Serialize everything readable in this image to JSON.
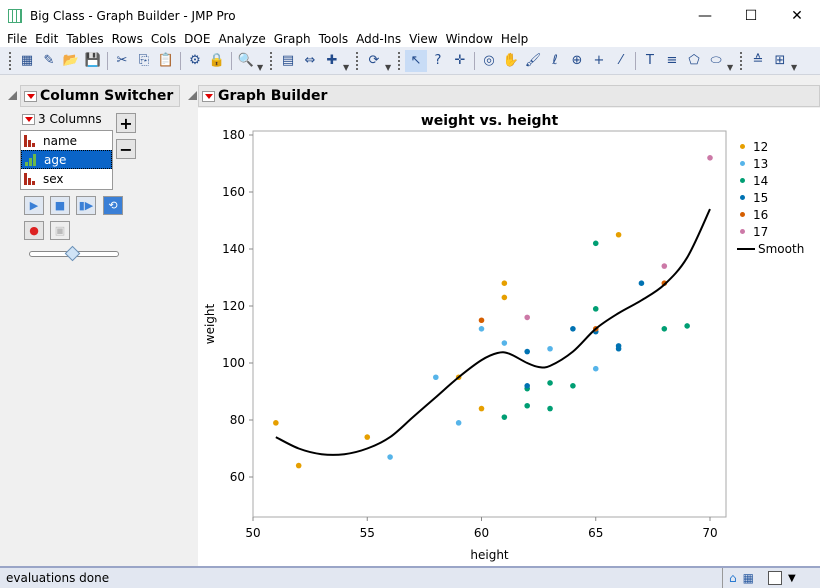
{
  "window": {
    "title": "Big Class - Graph Builder - JMP Pro",
    "minimize": "—",
    "maximize": "☐",
    "close": "✕"
  },
  "menu": [
    "File",
    "Edit",
    "Tables",
    "Rows",
    "Cols",
    "DOE",
    "Analyze",
    "Graph",
    "Tools",
    "Add-Ins",
    "View",
    "Window",
    "Help"
  ],
  "toolbar": {
    "icons": [
      "new-data-table",
      "new-script",
      "open",
      "save",
      "cut",
      "copy",
      "paste",
      "preferences",
      "lock",
      "search",
      "data-grid",
      "column-resize",
      "add-rows",
      "run-script",
      "arrow-select",
      "help",
      "crosshair",
      "brush-select",
      "hand",
      "brush",
      "lasso",
      "zoom",
      "plus",
      "ruler",
      "annotate",
      "line-arrow",
      "polygon",
      "ellipse",
      "sort",
      "grid"
    ]
  },
  "column_switcher": {
    "title": "Column Switcher",
    "count_label": "3 Columns",
    "columns": [
      "name",
      "age",
      "sex"
    ],
    "selected": "age",
    "add": "+",
    "remove": "−"
  },
  "graph_builder": {
    "title": "Graph Builder"
  },
  "status": {
    "text": "evaluations done"
  },
  "chart_data": {
    "type": "scatter",
    "title": "weight vs. height",
    "xlabel": "height",
    "ylabel": "weight",
    "xlim": [
      50,
      70.7
    ],
    "ylim": [
      45,
      183
    ],
    "xticks": [
      50,
      55,
      60,
      65,
      70
    ],
    "yticks": [
      60,
      80,
      100,
      120,
      140,
      160,
      180
    ],
    "legend_position": "right",
    "series": [
      {
        "name": "12",
        "color": "#E69F00",
        "points": [
          [
            51,
            79
          ],
          [
            52,
            64
          ],
          [
            55,
            74
          ],
          [
            59,
            95
          ],
          [
            60,
            84
          ],
          [
            61,
            128
          ],
          [
            61,
            123
          ],
          [
            66,
            145
          ]
        ]
      },
      {
        "name": "13",
        "color": "#56B4E9",
        "points": [
          [
            60,
            112
          ],
          [
            61,
            107
          ],
          [
            56,
            67
          ],
          [
            65,
            98
          ],
          [
            63,
            105
          ],
          [
            58,
            95
          ],
          [
            59,
            79
          ]
        ]
      },
      {
        "name": "14",
        "color": "#009E73",
        "points": [
          [
            65,
            142
          ],
          [
            61,
            81
          ],
          [
            62,
            85
          ],
          [
            65,
            119
          ],
          [
            63,
            84
          ],
          [
            68,
            112
          ],
          [
            69,
            113
          ],
          [
            64,
            92
          ],
          [
            63,
            93
          ],
          [
            62,
            91
          ]
        ]
      },
      {
        "name": "15",
        "color": "#0072B2",
        "points": [
          [
            67,
            128
          ],
          [
            62,
            104
          ],
          [
            64,
            112
          ],
          [
            65,
            111
          ],
          [
            66,
            106
          ],
          [
            66,
            105
          ],
          [
            62,
            92
          ]
        ]
      },
      {
        "name": "16",
        "color": "#D55E00",
        "points": [
          [
            60,
            115
          ],
          [
            68,
            128
          ],
          [
            65,
            112
          ]
        ]
      },
      {
        "name": "17",
        "color": "#CC79A7",
        "points": [
          [
            62,
            116
          ],
          [
            68,
            134
          ],
          [
            70,
            172
          ]
        ]
      }
    ],
    "smooth": {
      "name": "Smooth",
      "color": "#000000",
      "points": [
        [
          51,
          74
        ],
        [
          52,
          70
        ],
        [
          53,
          68
        ],
        [
          54,
          68
        ],
        [
          55,
          70
        ],
        [
          56,
          74
        ],
        [
          57,
          81
        ],
        [
          58,
          88
        ],
        [
          59,
          95
        ],
        [
          60,
          101
        ],
        [
          60.7,
          103.5
        ],
        [
          61.2,
          103.3
        ],
        [
          62,
          100
        ],
        [
          62.5,
          98.6
        ],
        [
          63,
          99
        ],
        [
          64,
          104
        ],
        [
          65,
          112
        ],
        [
          66,
          117.5
        ],
        [
          67,
          122
        ],
        [
          68,
          127.5
        ],
        [
          69,
          137
        ],
        [
          70,
          154
        ]
      ]
    }
  }
}
